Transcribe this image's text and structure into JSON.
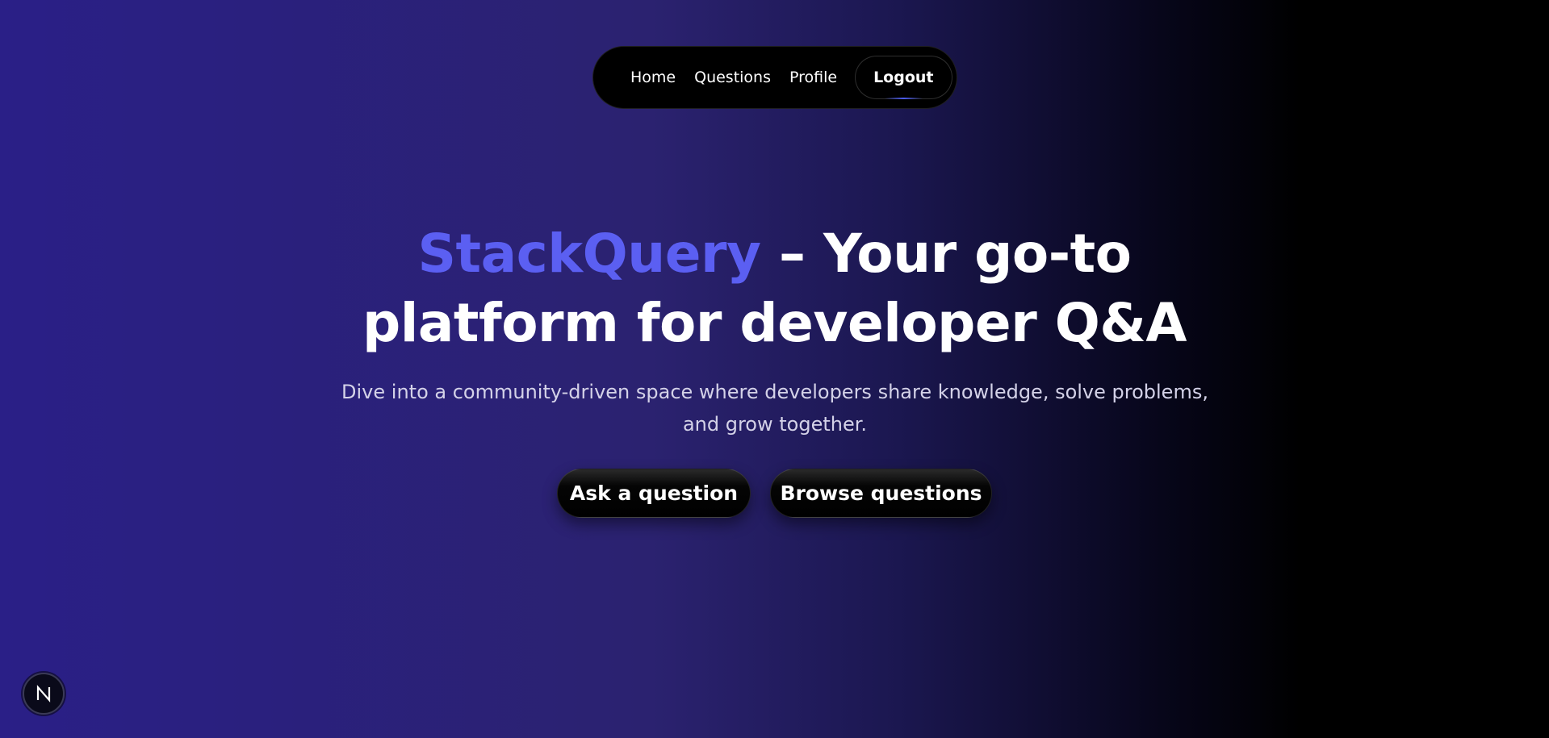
{
  "nav": {
    "items": [
      {
        "label": "Home"
      },
      {
        "label": "Questions"
      },
      {
        "label": "Profile"
      }
    ],
    "logout_label": "Logout"
  },
  "hero": {
    "brand": "StackQuery",
    "title_line1_rest": " – Your go-to",
    "title_line2": "platform for developer Q&A",
    "subtitle": "Dive into a community-driven space where developers share knowledge, solve problems, and grow together.",
    "ask_label": "Ask a question",
    "browse_label": "Browse questions"
  },
  "badge": {
    "icon": "next-n-icon"
  },
  "colors": {
    "brand": "#5b5ff2",
    "background_left": "#2a1f87",
    "background_right": "#000000"
  }
}
